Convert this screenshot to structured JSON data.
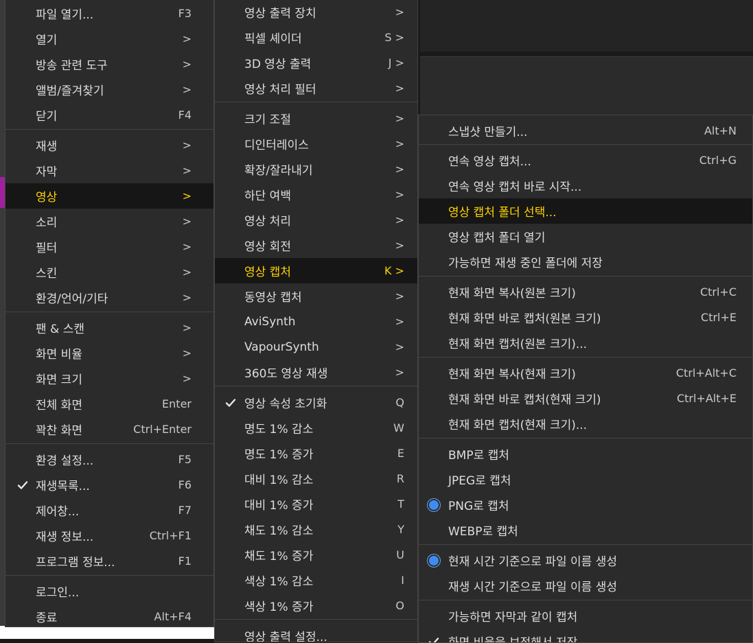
{
  "menu_main": {
    "items": [
      {
        "label": "파일 열기...",
        "shortcut": "F3"
      },
      {
        "label": "열기",
        "shortcut": ">"
      },
      {
        "label": "방송 관련 도구",
        "shortcut": ">"
      },
      {
        "label": "앨범/즐겨찾기",
        "shortcut": ">"
      },
      {
        "label": "닫기",
        "shortcut": "F4"
      },
      {
        "label": "재생",
        "shortcut": ">"
      },
      {
        "label": "자막",
        "shortcut": ">"
      },
      {
        "label": "영상",
        "shortcut": ">"
      },
      {
        "label": "소리",
        "shortcut": ">"
      },
      {
        "label": "필터",
        "shortcut": ">"
      },
      {
        "label": "스킨",
        "shortcut": ">"
      },
      {
        "label": "환경/언어/기타",
        "shortcut": ">"
      },
      {
        "label": "팬 & 스캔",
        "shortcut": ">"
      },
      {
        "label": "화면 비율",
        "shortcut": ">"
      },
      {
        "label": "화면 크기",
        "shortcut": ">"
      },
      {
        "label": "전체 화면",
        "shortcut": "Enter"
      },
      {
        "label": "꽉찬 화면",
        "shortcut": "Ctrl+Enter"
      },
      {
        "label": "환경 설정...",
        "shortcut": "F5"
      },
      {
        "label": "재생목록...",
        "shortcut": "F6"
      },
      {
        "label": "제어창...",
        "shortcut": "F7"
      },
      {
        "label": "재생 정보...",
        "shortcut": "Ctrl+F1"
      },
      {
        "label": "프로그램 정보...",
        "shortcut": "F1"
      },
      {
        "label": "로그인...",
        "shortcut": ""
      },
      {
        "label": "종료",
        "shortcut": "Alt+F4"
      }
    ]
  },
  "menu_video": {
    "items": [
      {
        "label": "영상 출력 장치",
        "shortcut": ">"
      },
      {
        "label": "픽셀 셰이더",
        "shortcut": "S >"
      },
      {
        "label": "3D 영상 출력",
        "shortcut": "J >"
      },
      {
        "label": "영상 처리 필터",
        "shortcut": ">"
      },
      {
        "label": "크기 조절",
        "shortcut": ">"
      },
      {
        "label": "디인터레이스",
        "shortcut": ">"
      },
      {
        "label": "확장/잘라내기",
        "shortcut": ">"
      },
      {
        "label": "하단 여백",
        "shortcut": ">"
      },
      {
        "label": "영상 처리",
        "shortcut": ">"
      },
      {
        "label": "영상 회전",
        "shortcut": ">"
      },
      {
        "label": "영상 캡처",
        "shortcut": "K >"
      },
      {
        "label": "동영상 캡처",
        "shortcut": ">"
      },
      {
        "label": "AviSynth",
        "shortcut": ">"
      },
      {
        "label": "VapourSynth",
        "shortcut": ">"
      },
      {
        "label": "360도 영상 재생",
        "shortcut": ">"
      },
      {
        "label": "영상 속성 초기화",
        "shortcut": "Q"
      },
      {
        "label": "명도 1% 감소",
        "shortcut": "W"
      },
      {
        "label": "명도 1% 증가",
        "shortcut": "E"
      },
      {
        "label": "대비 1% 감소",
        "shortcut": "R"
      },
      {
        "label": "대비 1% 증가",
        "shortcut": "T"
      },
      {
        "label": "채도 1% 감소",
        "shortcut": "Y"
      },
      {
        "label": "채도 1% 증가",
        "shortcut": "U"
      },
      {
        "label": "색상 1% 감소",
        "shortcut": "I"
      },
      {
        "label": "색상 1% 증가",
        "shortcut": "O"
      },
      {
        "label": "영상 출력 설정...",
        "shortcut": ""
      }
    ]
  },
  "menu_capture": {
    "items": [
      {
        "label": "스냅샷 만들기...",
        "shortcut": "Alt+N"
      },
      {
        "label": "연속 영상 캡처...",
        "shortcut": "Ctrl+G"
      },
      {
        "label": "연속 영상 캡처 바로 시작...",
        "shortcut": ""
      },
      {
        "label": "영상 캡처 폴더 선택...",
        "shortcut": ""
      },
      {
        "label": "영상 캡처 폴더 열기",
        "shortcut": ""
      },
      {
        "label": "가능하면 재생 중인 폴더에 저장",
        "shortcut": ""
      },
      {
        "label": "현재 화면 복사(원본 크기)",
        "shortcut": "Ctrl+C"
      },
      {
        "label": "현재 화면 바로 캡처(원본 크기)",
        "shortcut": "Ctrl+E"
      },
      {
        "label": "현재 화면 캡처(원본 크기)...",
        "shortcut": ""
      },
      {
        "label": "현재 화면 복사(현재 크기)",
        "shortcut": "Ctrl+Alt+C"
      },
      {
        "label": "현재 화면 바로 캡처(현재 크기)",
        "shortcut": "Ctrl+Alt+E"
      },
      {
        "label": "현재 화면 캡처(현재 크기)...",
        "shortcut": ""
      },
      {
        "label": "BMP로 캡처",
        "shortcut": ""
      },
      {
        "label": "JPEG로 캡처",
        "shortcut": ""
      },
      {
        "label": "PNG로 캡처",
        "shortcut": ""
      },
      {
        "label": "WEBP로 캡처",
        "shortcut": ""
      },
      {
        "label": "현재 시간 기준으로 파일 이름 생성",
        "shortcut": ""
      },
      {
        "label": "재생 시간 기준으로 파일 이름 생성",
        "shortcut": ""
      },
      {
        "label": "가능하면 자막과 같이 캡처",
        "shortcut": ""
      },
      {
        "label": "화면 비율을 보정해서 저장",
        "shortcut": ""
      }
    ]
  },
  "colors": {
    "menu_bg": "#2b2b2b",
    "highlight_bg": "#161616",
    "highlight_text": "#ffd200",
    "radio": "#3f8cf0"
  }
}
